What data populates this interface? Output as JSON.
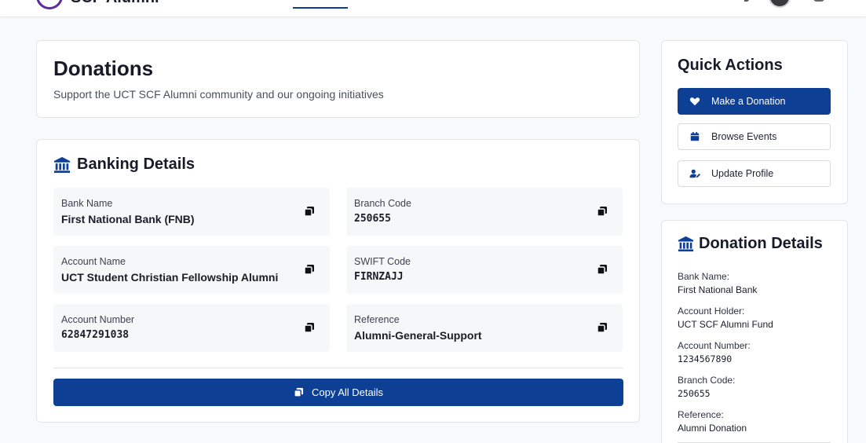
{
  "nav": {
    "brand": "SCF Alumni",
    "colors": {
      "brand_purple": "#5b2c9a",
      "accent_blue": "#0d3f94"
    }
  },
  "header": {
    "title": "Donations",
    "subtitle": "Support the UCT SCF Alumni community and our ongoing initiatives"
  },
  "banking": {
    "title": "Banking Details",
    "icon": "bank-icon",
    "fields": [
      {
        "label": "Bank Name",
        "value": "First National Bank (FNB)"
      },
      {
        "label": "Branch Code",
        "value": "250655"
      },
      {
        "label": "Account Name",
        "value": "UCT Student Christian Fellowship Alumni"
      },
      {
        "label": "SWIFT Code",
        "value": "FIRNZAJJ"
      },
      {
        "label": "Account Number",
        "value": "62847291038"
      },
      {
        "label": "Reference",
        "value": "Alumni-General-Support"
      }
    ],
    "copy_all_label": "Copy All Details"
  },
  "quick_actions": {
    "title": "Quick Actions",
    "buttons": [
      {
        "label": "Make a Donation",
        "icon": "heart-icon"
      },
      {
        "label": "Browse Events",
        "icon": "calendar-icon"
      },
      {
        "label": "Update Profile",
        "icon": "user-edit-icon"
      }
    ]
  },
  "donation_details": {
    "title": "Donation Details",
    "icon": "bank-icon",
    "items": [
      {
        "label": "Bank Name:",
        "value": "First National Bank"
      },
      {
        "label": "Account Holder:",
        "value": "UCT SCF Alumni Fund"
      },
      {
        "label": "Account Number:",
        "value": "1234567890"
      },
      {
        "label": "Branch Code:",
        "value": "250655"
      },
      {
        "label": "Reference:",
        "value": "Alumni Donation"
      }
    ]
  }
}
